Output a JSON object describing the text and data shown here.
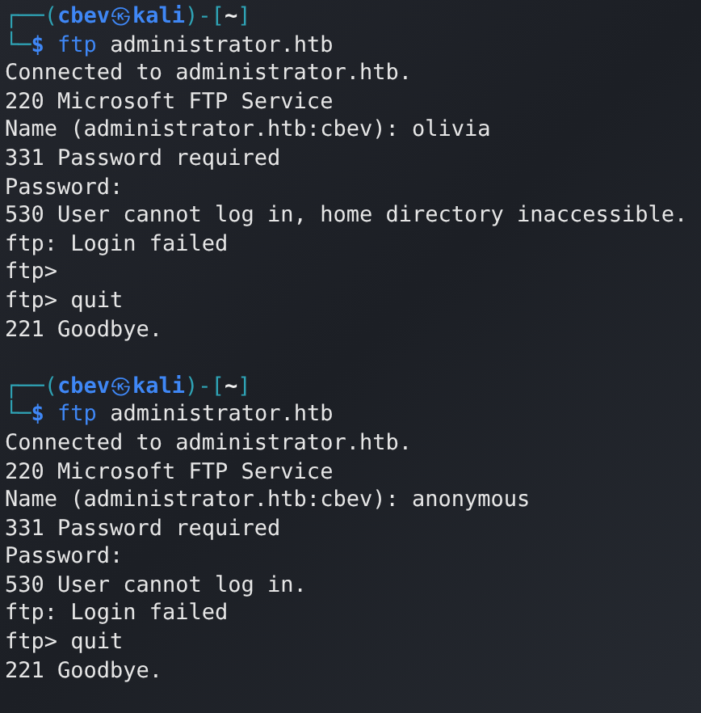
{
  "sessions": [
    {
      "prompt": {
        "frame_top": "┌──(",
        "user": "cbev",
        "symbol": "㉿",
        "host": "kali",
        "frame_mid": ")-[",
        "dir": "~",
        "frame_end": "]",
        "frame_bottom": "└─",
        "sign": "$"
      },
      "command": {
        "program": "ftp",
        "argument": "administrator.htb"
      },
      "output": [
        "Connected to administrator.htb.",
        "220 Microsoft FTP Service",
        "Name (administrator.htb:cbev): olivia",
        "331 Password required",
        "Password:",
        "530 User cannot log in, home directory inaccessible.",
        "ftp: Login failed",
        "ftp>",
        "ftp> quit",
        "221 Goodbye."
      ]
    },
    {
      "prompt": {
        "frame_top": "┌──(",
        "user": "cbev",
        "symbol": "㉿",
        "host": "kali",
        "frame_mid": ")-[",
        "dir": "~",
        "frame_end": "]",
        "frame_bottom": "└─",
        "sign": "$"
      },
      "command": {
        "program": "ftp",
        "argument": "administrator.htb"
      },
      "output": [
        "Connected to administrator.htb.",
        "220 Microsoft FTP Service",
        "Name (administrator.htb:cbev): anonymous",
        "331 Password required",
        "Password:",
        "530 User cannot log in.",
        "ftp: Login failed",
        "ftp> quit",
        "221 Goodbye."
      ]
    }
  ]
}
